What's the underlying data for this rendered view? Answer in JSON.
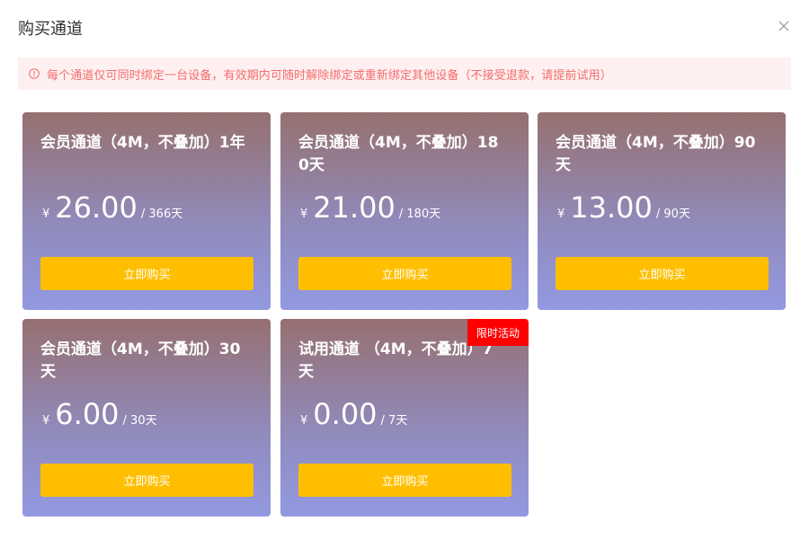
{
  "dialog": {
    "title": "购买通道"
  },
  "alert": {
    "icon": "info-circle-icon",
    "text": "每个通道仅可同时绑定一台设备，有效期内可随时解除绑定或重新绑定其他设备（不接受退款，请提前试用）",
    "color": "#f56c6c",
    "background": "#fef0f0"
  },
  "colors": {
    "button": "#ffbf00",
    "badge": "#ff0000",
    "card_gradient_top": "#967070",
    "card_gradient_bottom": "#9299e1"
  },
  "plans": [
    {
      "name": "会员通道（4M，不叠加）1年",
      "currency": "¥",
      "price": "26.00",
      "period": "/ 366天",
      "button": "立即购买",
      "badge": ""
    },
    {
      "name": "会员通道（4M，不叠加）180天",
      "currency": "¥",
      "price": "21.00",
      "period": "/ 180天",
      "button": "立即购买",
      "badge": ""
    },
    {
      "name": "会员通道（4M，不叠加）90天",
      "currency": "¥",
      "price": "13.00",
      "period": "/ 90天",
      "button": "立即购买",
      "badge": ""
    },
    {
      "name": "会员通道（4M，不叠加）30天",
      "currency": "¥",
      "price": "6.00",
      "period": "/ 30天",
      "button": "立即购买",
      "badge": ""
    },
    {
      "name": "试用通道 （4M，不叠加）7天",
      "currency": "¥",
      "price": "0.00",
      "period": "/ 7天",
      "button": "立即购买",
      "badge": "限时活动"
    }
  ]
}
